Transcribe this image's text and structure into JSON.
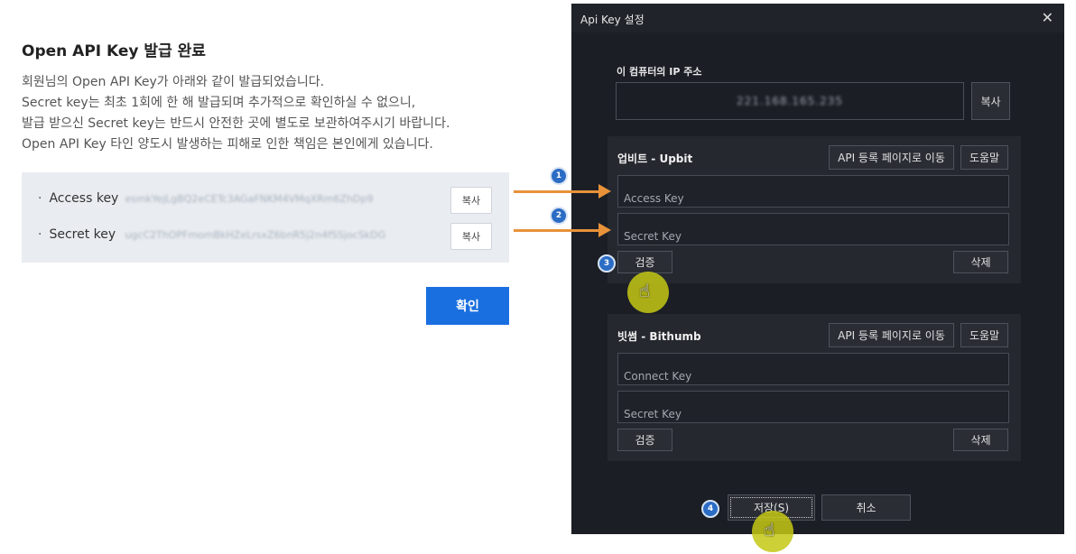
{
  "web": {
    "title": "Open API Key 발급 완료",
    "desc_lines": [
      "회원님의 Open API Key가 아래와 같이 발급되었습니다.",
      "Secret key는 최초 1회에 한 해 발급되며 추가적으로 확인하실 수 없으니,",
      "발급 받으신 Secret key는 반드시 안전한 곳에 별도로 보관하여주시기 바랍니다.",
      "Open API Key 타인 양도시 발생하는 피해로 인한 책임은 본인에게 있습니다."
    ],
    "access_key_label": "Access key",
    "access_key_value": "esmkYejLgBQ2eCETc3AGaFNKM4VMqXRm6ZhDp9",
    "secret_key_label": "Secret key",
    "secret_key_value": "ugcC2ThOPFmomBkHZeLrsxZ6bnR5j2n4fSSjocSkDG",
    "copy_label": "복사",
    "confirm_label": "확인"
  },
  "steps": [
    "1",
    "2",
    "3",
    "4"
  ],
  "dialog": {
    "title": "Api Key 설정",
    "close_icon": "✕",
    "ip_label": "이 컴퓨터의 IP 주소",
    "ip_value": "221.168.165.235",
    "copy_label": "복사",
    "upbit": {
      "title": "업비트 - Upbit",
      "register_label": "API 등록 페이지로 이동",
      "help_label": "도움말",
      "access_placeholder": "Access Key",
      "secret_placeholder": "Secret Key",
      "verify_label": "검증",
      "delete_label": "삭제"
    },
    "bithumb": {
      "title": "빗썸 - Bithumb",
      "register_label": "API 등록 페이지로 이동",
      "help_label": "도움말",
      "connect_placeholder": "Connect Key",
      "secret_placeholder": "Secret Key",
      "verify_label": "검증",
      "delete_label": "삭제"
    },
    "save_label": "저장(S)",
    "cancel_label": "취소"
  },
  "colors": {
    "accent": "#1a6fe0",
    "arrow": "#e8923a",
    "step_badge": "#2b6cc4",
    "dialog_bg": "#1b1e25",
    "cursor_highlight": "#c4c814"
  },
  "icons": {
    "bullet": "·",
    "hand_cursor": "☝"
  }
}
